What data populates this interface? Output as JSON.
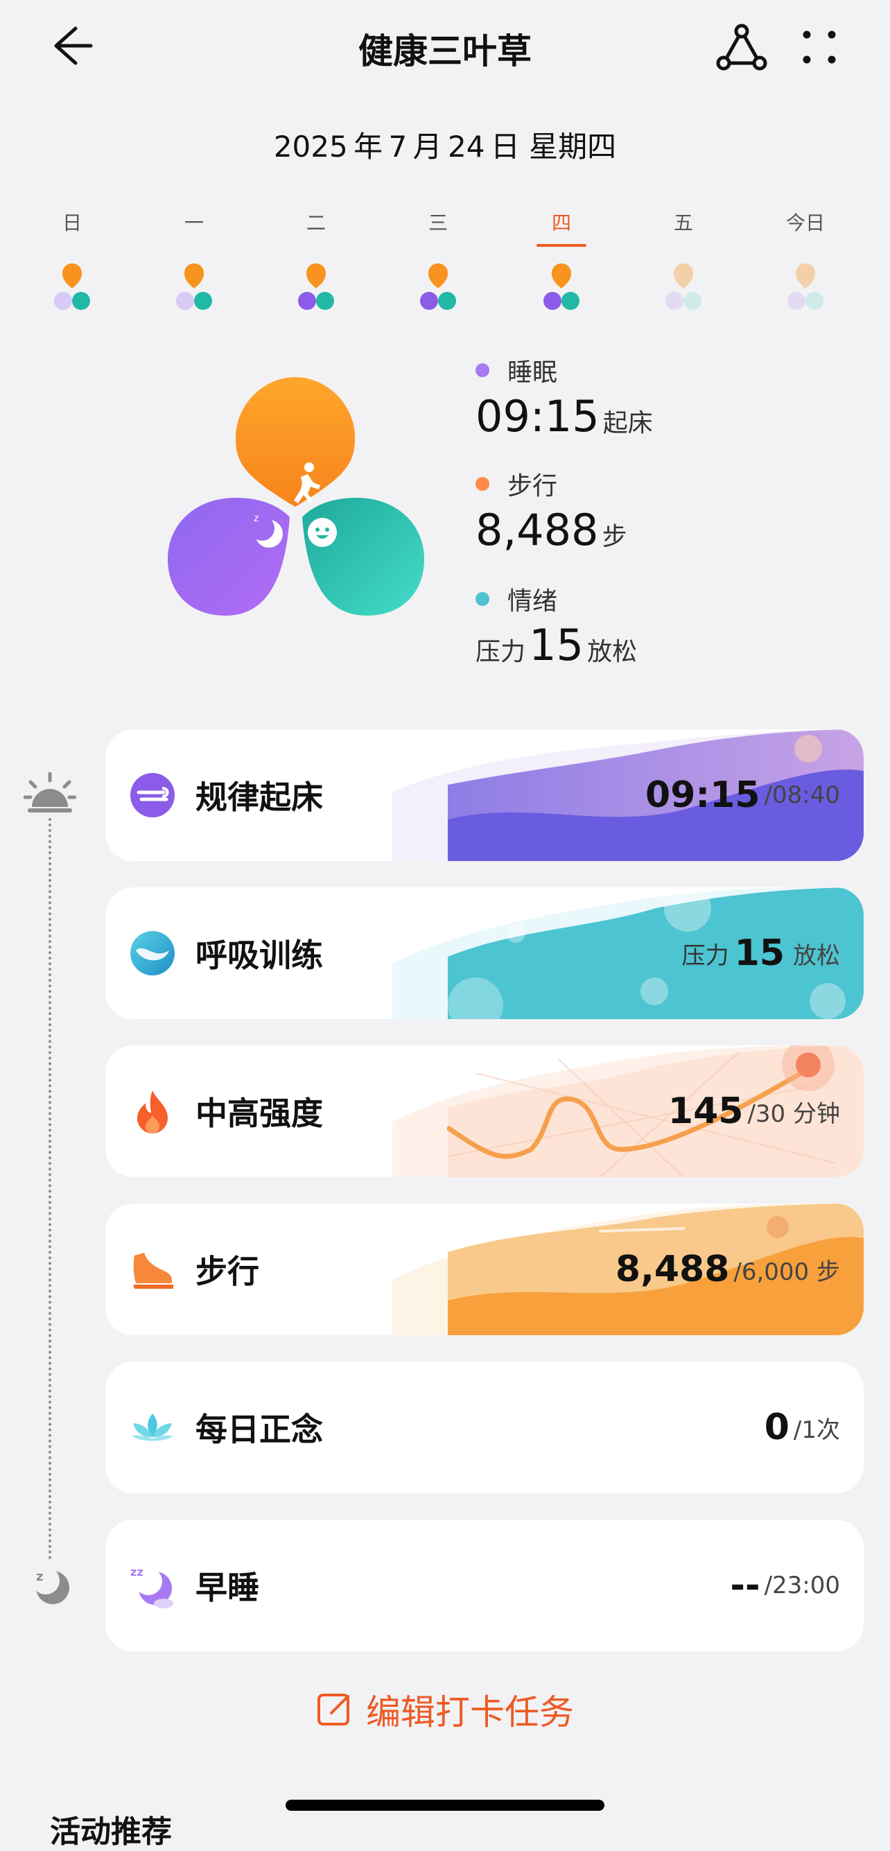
{
  "header": {
    "title": "健康三叶草"
  },
  "date_line": "2025 年 7 月 24 日 星期四",
  "week": [
    {
      "label": "日",
      "active": false
    },
    {
      "label": "一",
      "active": false
    },
    {
      "label": "二",
      "active": false
    },
    {
      "label": "三",
      "active": false
    },
    {
      "label": "四",
      "active": true
    },
    {
      "label": "五",
      "active": false
    },
    {
      "label": "今日",
      "active": false
    }
  ],
  "summary": {
    "sleep": {
      "label": "睡眠",
      "value": "09:15",
      "unit": "起床",
      "color": "#a77af2"
    },
    "steps": {
      "label": "步行",
      "value": "8,488",
      "unit": "步",
      "color": "#ff8a4c"
    },
    "mood": {
      "label": "情绪",
      "prefix": "压力",
      "value": "15",
      "unit": "放松",
      "color": "#4fc3d0"
    }
  },
  "tasks": [
    {
      "name": "规律起床",
      "value": "09:15",
      "target": "/08:40",
      "icon": "wake-icon"
    },
    {
      "name": "呼吸训练",
      "prefix": "压力",
      "value": "15",
      "target": "放松",
      "icon": "breath-icon"
    },
    {
      "name": "中高强度",
      "value": "145",
      "target": "/30 分钟",
      "icon": "flame-icon"
    },
    {
      "name": "步行",
      "value": "8,488",
      "target": "/6,000 步",
      "icon": "shoe-icon"
    },
    {
      "name": "每日正念",
      "value": "0",
      "target": "/1次",
      "icon": "lotus-icon"
    },
    {
      "name": "早睡",
      "value": "--",
      "target": "/23:00",
      "icon": "moon-icon"
    }
  ],
  "edit_label": "编辑打卡任务",
  "section_title": "活动推荐"
}
